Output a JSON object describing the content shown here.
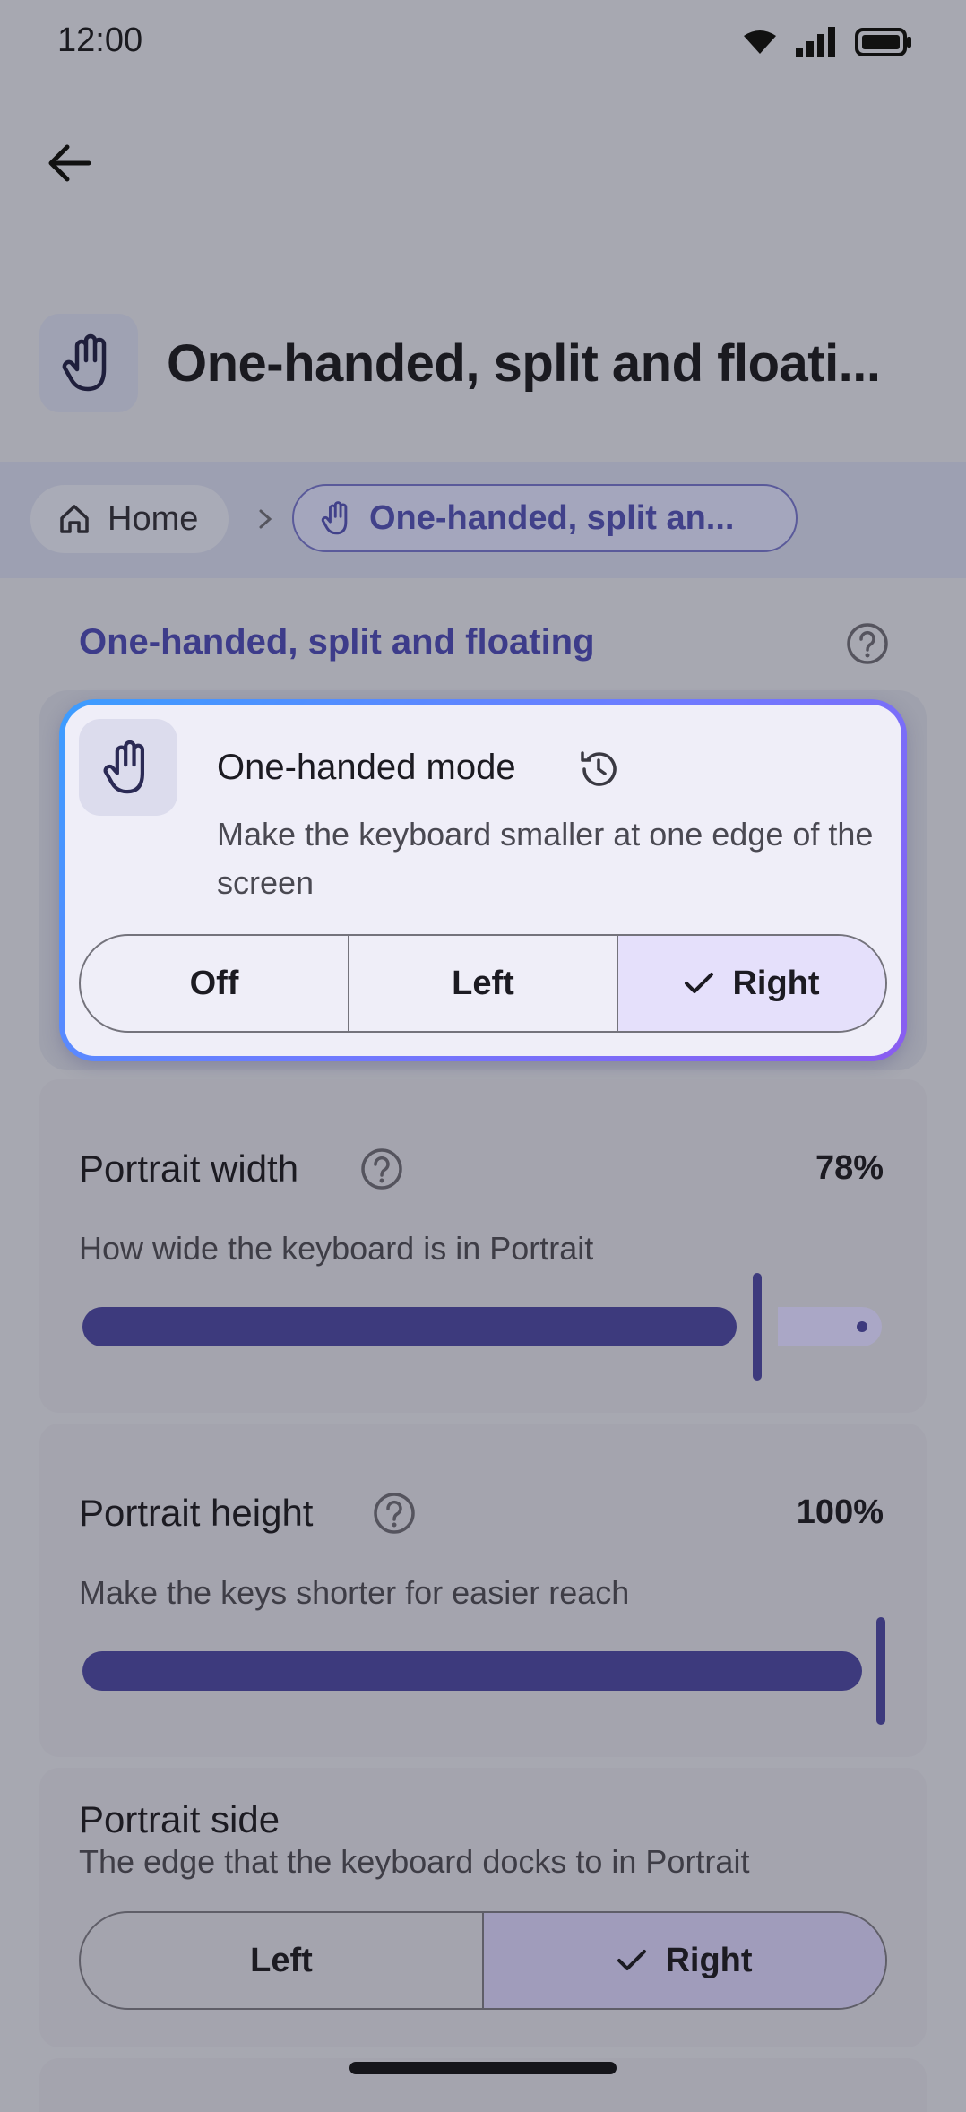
{
  "status": {
    "time": "12:00"
  },
  "header": {
    "title": "One-handed, split and floati..."
  },
  "breadcrumb": {
    "home": "Home",
    "current": "One-handed, split an..."
  },
  "section": {
    "title": "One-handed, split and floating"
  },
  "one_handed": {
    "title": "One-handed mode",
    "description": "Make the keyboard smaller at one edge of the screen",
    "options": [
      "Off",
      "Left",
      "Right"
    ],
    "selected": "Right"
  },
  "portrait_width": {
    "label": "Portrait width",
    "value": "78%",
    "level_percent": 78,
    "description": "How wide the keyboard is in Portrait"
  },
  "portrait_height": {
    "label": "Portrait height",
    "value": "100%",
    "level_percent": 100,
    "description": "Make the keys shorter for easier reach"
  },
  "portrait_side": {
    "label": "Portrait side",
    "description": "The edge that the keyboard docks to in Portrait",
    "options": [
      "Left",
      "Right"
    ],
    "selected": "Right"
  },
  "colors": {
    "accent": "#3d3a7d",
    "card_border_start": "#3c9dff",
    "card_border_end": "#8a5cf0"
  },
  "icons": [
    "wifi-icon",
    "signal-icon",
    "battery-icon",
    "back-arrow-icon",
    "hand-icon",
    "home-icon",
    "chevron-right-icon",
    "help-icon",
    "history-icon",
    "check-icon"
  ]
}
